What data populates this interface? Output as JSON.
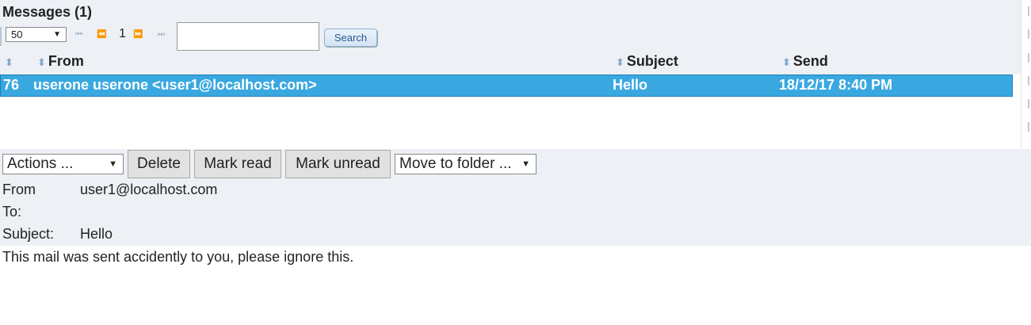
{
  "messages": {
    "title": "Messages (1)",
    "page_size": "50",
    "pager": {
      "first": "⏮",
      "prev": "⏪",
      "page": "1",
      "next": "⏩",
      "last": "⏭"
    },
    "search_value": "",
    "search_label": "Search",
    "columns": {
      "from": "From",
      "subject": "Subject",
      "send": "Send"
    },
    "rows": [
      {
        "id": "76",
        "from": "userone userone <user1@localhost.com>",
        "subject": "Hello",
        "send": "18/12/17 8:40 PM"
      }
    ]
  },
  "toolbar": {
    "actions": "Actions ...",
    "delete": "Delete",
    "mark_read": "Mark read",
    "mark_unread": "Mark unread",
    "move_to_folder": "Move to folder ..."
  },
  "detail": {
    "from_label": "From",
    "from_value": "user1@localhost.com",
    "to_label": "To:",
    "to_value": "",
    "subject_label": "Subject:",
    "subject_value": "Hello",
    "body": "This mail was sent accidently to you, please ignore this."
  },
  "colors": {
    "selected_row": "#3aa8e0",
    "panel": "#edf0f4"
  },
  "icons": {
    "sort": "sort-updown-icon",
    "dropdown": "dropdown-triangle-icon"
  }
}
